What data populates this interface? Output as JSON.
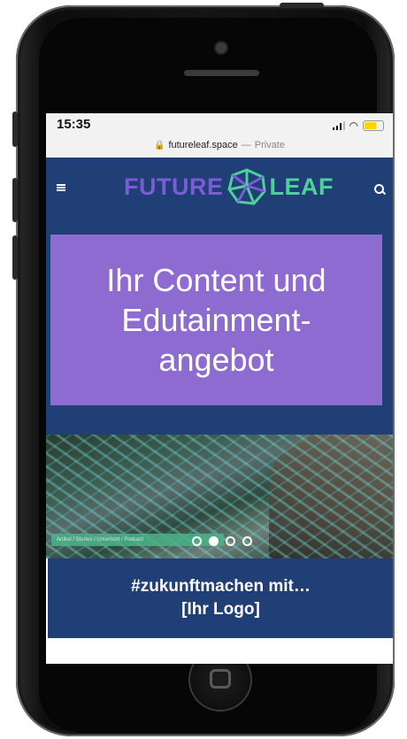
{
  "status_bar": {
    "time": "15:35"
  },
  "url_bar": {
    "domain": "futureleaf.space",
    "separator": "—",
    "mode": "Private"
  },
  "nav": {
    "logo_left": "FUTURE",
    "logo_right": "LEAF"
  },
  "hero": {
    "line1": "Ihr Content und",
    "line2": "Edutainment-",
    "line3": "angebot"
  },
  "slider": {
    "caption": "Artikel / Stories / Unterricht / Podcast",
    "dots": 4,
    "active_dot": 1
  },
  "banner": {
    "line1": "#zukunftmachen mit…",
    "line2": "[Ihr Logo]"
  },
  "colors": {
    "navy": "#1f3f76",
    "purple": "#8e6bd0",
    "logo_purple": "#7b5bd6",
    "logo_green": "#4fcf9a"
  }
}
